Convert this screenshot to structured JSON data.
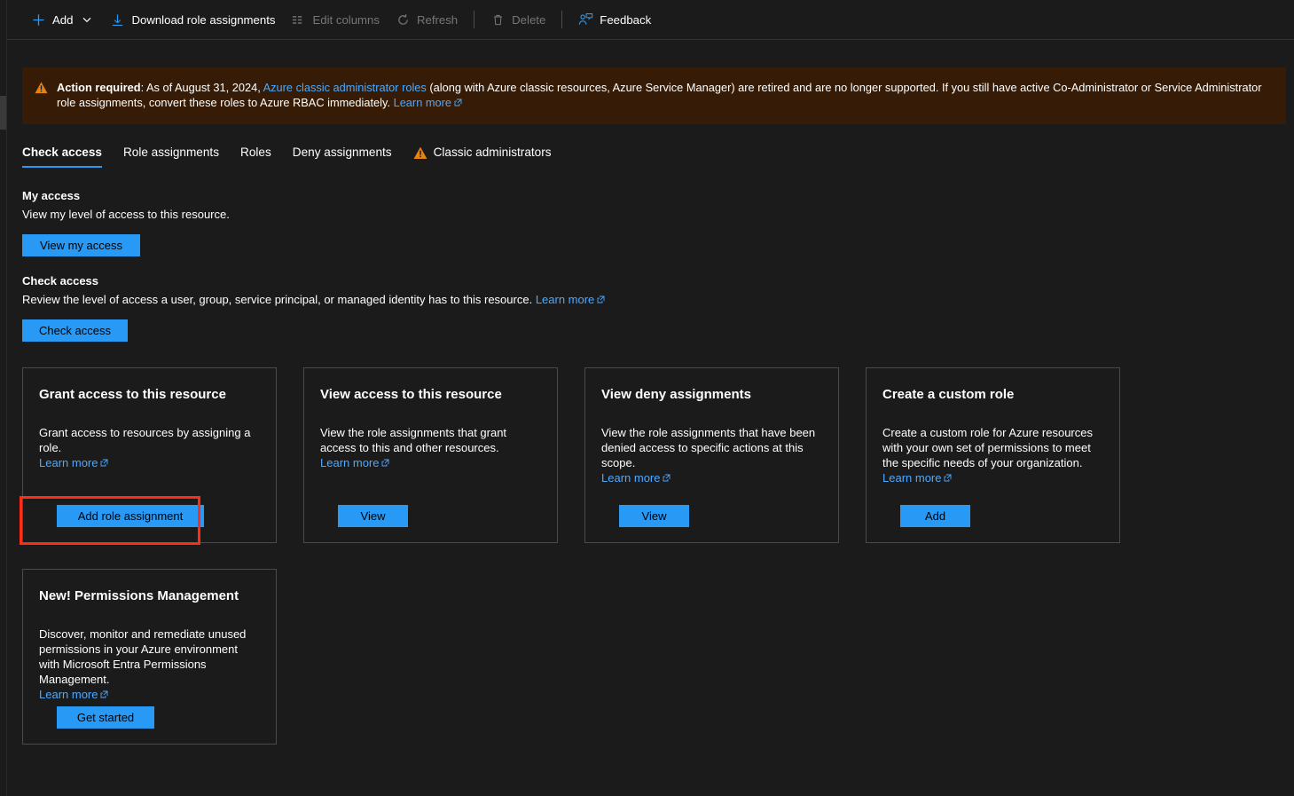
{
  "toolbar": {
    "add_label": "Add",
    "add_icon": "plus-icon",
    "add_chevron_icon": "chevron-down-icon",
    "download_label": "Download role assignments",
    "download_icon": "download-icon",
    "edit_columns_label": "Edit columns",
    "edit_columns_icon": "columns-icon",
    "refresh_label": "Refresh",
    "refresh_icon": "refresh-icon",
    "delete_label": "Delete",
    "delete_icon": "trash-icon",
    "feedback_label": "Feedback",
    "feedback_icon": "feedback-person-icon"
  },
  "banner": {
    "icon": "warning-triangle-icon",
    "strong": "Action required",
    "text_1": ": As of August 31, 2024, ",
    "link_1": "Azure classic administrator roles",
    "text_2": " (along with Azure classic resources, Azure Service Manager) are retired and are no longer supported. If you still have active Co-Administrator or Service Administrator role assignments, convert these roles to Azure RBAC immediately. ",
    "link_2": "Learn more",
    "background": "#361c06"
  },
  "tabs": [
    {
      "label": "Check access",
      "active": true,
      "icon": null
    },
    {
      "label": "Role assignments",
      "active": false,
      "icon": null
    },
    {
      "label": "Roles",
      "active": false,
      "icon": null
    },
    {
      "label": "Deny assignments",
      "active": false,
      "icon": null
    },
    {
      "label": "Classic administrators",
      "active": false,
      "icon": "warning-triangle-icon"
    }
  ],
  "my_access": {
    "title": "My access",
    "description": "View my level of access to this resource.",
    "button": "View my access"
  },
  "check_access": {
    "title": "Check access",
    "description": "Review the level of access a user, group, service principal, or managed identity has to this resource.",
    "learn_more": "Learn more",
    "button": "Check access"
  },
  "cards": {
    "grant": {
      "title": "Grant access to this resource",
      "description": "Grant access to resources by assigning a role.",
      "learn_more": "Learn more",
      "button": "Add role assignment"
    },
    "view": {
      "title": "View access to this resource",
      "description": "View the role assignments that grant access to this and other resources.",
      "learn_more": "Learn more",
      "button": "View"
    },
    "deny": {
      "title": "View deny assignments",
      "description": "View the role assignments that have been denied access to specific actions at this scope.",
      "learn_more": "Learn more",
      "button": "View"
    },
    "custom": {
      "title": "Create a custom role",
      "description": "Create a custom role for Azure resources with your own set of permissions to meet the specific needs of your organization.",
      "learn_more": "Learn more",
      "button": "Add"
    },
    "permissions": {
      "title": "New! Permissions Management",
      "description": "Discover, monitor and remediate unused permissions in your Azure environment with Microsoft Entra Permissions Management.",
      "learn_more": "Learn more",
      "button": "Get started"
    }
  },
  "annotation": {
    "highlight_color": "#ff2d18",
    "highlight_target": "Add role assignment"
  },
  "theme": {
    "page_background": "#1b1b1b",
    "accent_blue": "#2899f5",
    "link_blue": "#4da9ff",
    "warning_orange": "#e8820c",
    "card_border": "#4a4a4a"
  }
}
